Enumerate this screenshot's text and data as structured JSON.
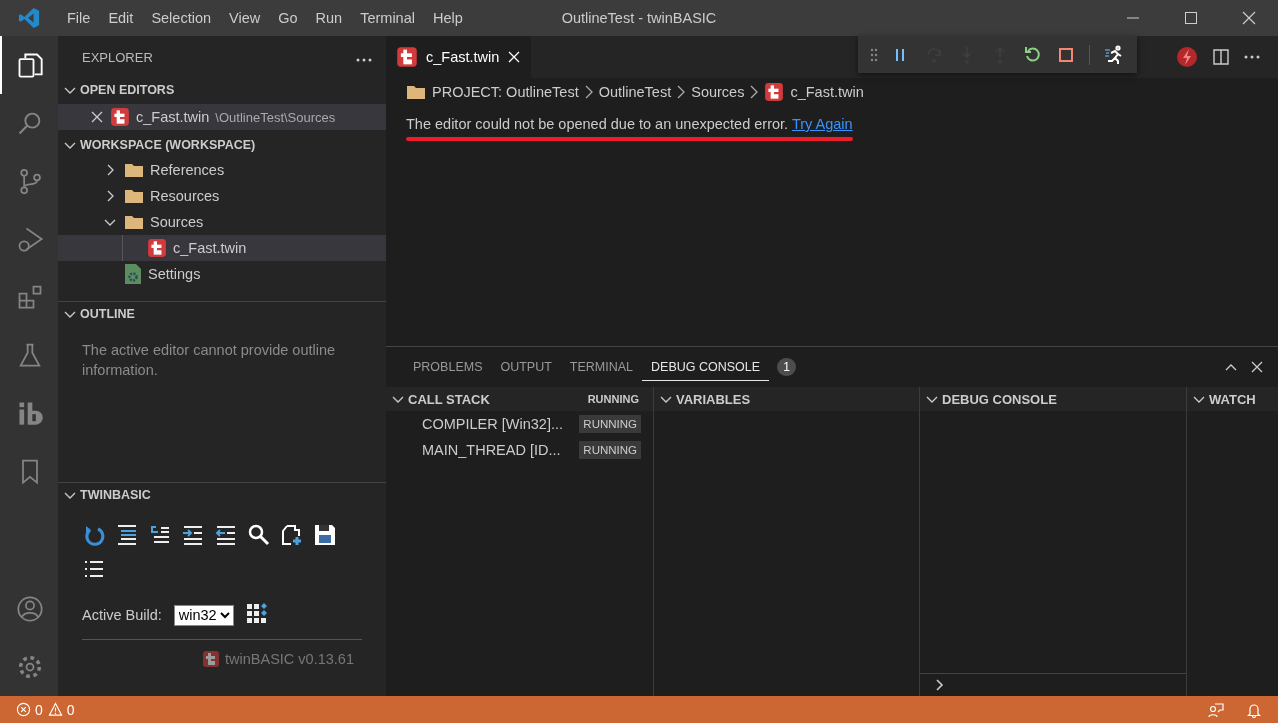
{
  "window": {
    "title": "OutlineTest - twinBASIC"
  },
  "menu": [
    "File",
    "Edit",
    "Selection",
    "View",
    "Go",
    "Run",
    "Terminal",
    "Help"
  ],
  "explorer": {
    "title": "EXPLORER",
    "open_editors": {
      "title": "OPEN EDITORS",
      "expanded": true,
      "items": [
        {
          "name": "c_Fast.twin",
          "path": "\\OutlineTest\\Sources",
          "selected": true
        }
      ]
    },
    "workspace": {
      "title": "WORKSPACE (WORKSPACE)",
      "expanded": true,
      "tree": [
        {
          "label": "References",
          "kind": "folder",
          "expanded": false,
          "selected": false
        },
        {
          "label": "Resources",
          "kind": "folder",
          "expanded": false,
          "selected": false
        },
        {
          "label": "Sources",
          "kind": "folder",
          "expanded": true,
          "selected": false,
          "children": [
            {
              "label": "c_Fast.twin",
              "kind": "twin",
              "selected": true
            }
          ]
        },
        {
          "label": "Settings",
          "kind": "settings",
          "selected": false
        }
      ]
    }
  },
  "outline": {
    "title": "OUTLINE",
    "expanded": true,
    "message": "The active editor cannot provide outline information."
  },
  "twinbasic": {
    "title": "TWINBASIC",
    "expanded": true,
    "build_label": "Active Build:",
    "build": "win32",
    "version": "twinBASIC v0.13.61"
  },
  "editor": {
    "tabs": [
      {
        "label": "c_Fast.twin",
        "selected": true
      }
    ],
    "debug_toolbar": [
      {
        "kind": "pause",
        "disabled": false
      },
      {
        "kind": "step-over",
        "disabled": true
      },
      {
        "kind": "step-into",
        "disabled": true
      },
      {
        "kind": "step-out",
        "disabled": true
      },
      {
        "kind": "restart",
        "disabled": false
      },
      {
        "kind": "stop",
        "disabled": false
      }
    ],
    "breadcrumb": [
      {
        "label": "PROJECT: OutlineTest",
        "kind": "folder"
      },
      {
        "label": "OutlineTest"
      },
      {
        "label": "Sources"
      },
      {
        "label": "c_Fast.twin",
        "kind": "twin"
      }
    ],
    "error": "The editor could not be opened due to an unexpected error.",
    "link": "Try Again"
  },
  "panel": {
    "tabs": [
      {
        "label": "PROBLEMS",
        "selected": false
      },
      {
        "label": "OUTPUT",
        "selected": false
      },
      {
        "label": "TERMINAL",
        "selected": false
      },
      {
        "label": "DEBUG CONSOLE",
        "selected": true,
        "badge": "1"
      }
    ],
    "call_stack": {
      "title": "CALL STACK",
      "status": "RUNNING",
      "expanded": true,
      "threads": [
        {
          "name": "COMPILER [Win32]...",
          "status": "RUNNING"
        },
        {
          "name": "MAIN_THREAD [ID...",
          "status": "RUNNING"
        }
      ]
    },
    "views": [
      {
        "title": "VARIABLES",
        "expanded": true
      },
      {
        "title": "DEBUG CONSOLE",
        "expanded": true
      },
      {
        "title": "WATCH",
        "expanded": true
      }
    ]
  },
  "status_bar": {
    "errors": "0",
    "warnings": "0"
  }
}
